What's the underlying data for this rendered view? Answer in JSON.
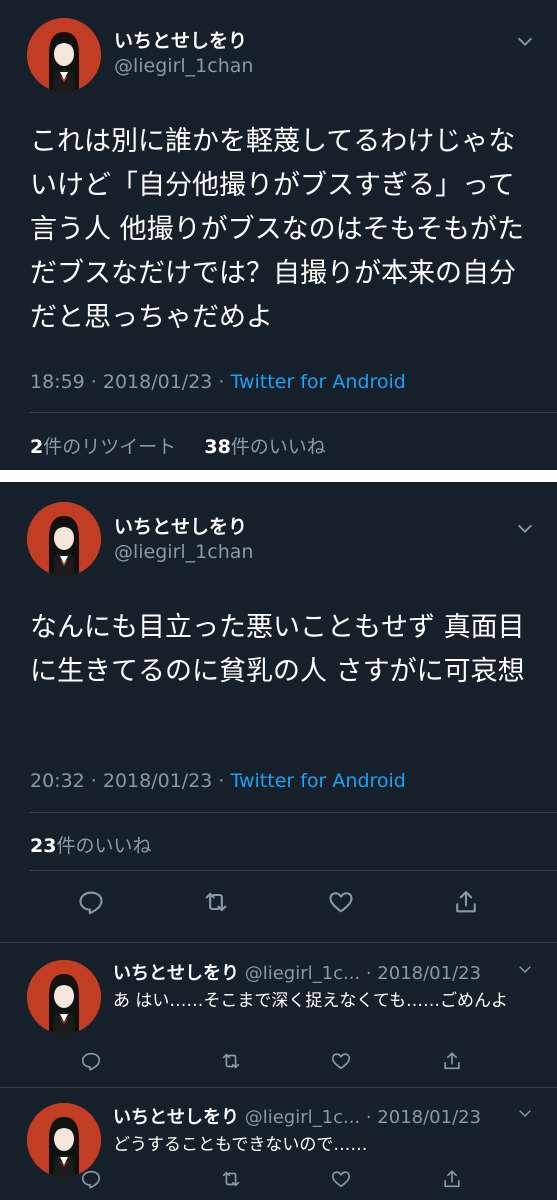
{
  "colors": {
    "background": "#15202b",
    "text": "#ffffff",
    "secondary": "#8899a6",
    "link": "#1da1f2",
    "avatar_bg": "#c23d24",
    "separator": "#ffffff"
  },
  "tweet1": {
    "display_name": "いちとせしをり",
    "handle": "@liegirl_1chan",
    "text": "これは別に誰かを軽蔑してるわけじゃないけど「自分他撮りがブスすぎる」って言う人 他撮りがブスなのはそもそもがただブスなだけでは？自撮りが本来の自分だと思っちゃだめよ",
    "time": "18:59 · 2018/01/23 · ",
    "app": "Twitter for Android",
    "retweet_count": "2",
    "retweet_label": "件のリツイート",
    "like_count": "38",
    "like_label": "件のいいね"
  },
  "tweet2": {
    "display_name": "いちとせしをり",
    "handle": "@liegirl_1chan",
    "text": "なんにも目立った悪いこともせず 真面目に生きてるのに貧乳の人 さすがに可哀想",
    "time": "20:32 · 2018/01/23 · ",
    "app": "Twitter for Android",
    "like_count": "23",
    "like_label": "件のいいね",
    "actions": [
      "reply-icon",
      "retweet-icon",
      "like-icon",
      "share-icon"
    ]
  },
  "replies": [
    {
      "display_name": "いちとせしをり",
      "handle_date": " @liegirl_1c... · 2018/01/23",
      "text": "あ はい……そこまで深く捉えなくても……ごめんよ"
    },
    {
      "display_name": "いちとせしをり",
      "handle_date": " @liegirl_1c... · 2018/01/23",
      "text": "どうすることもできないので……"
    }
  ]
}
